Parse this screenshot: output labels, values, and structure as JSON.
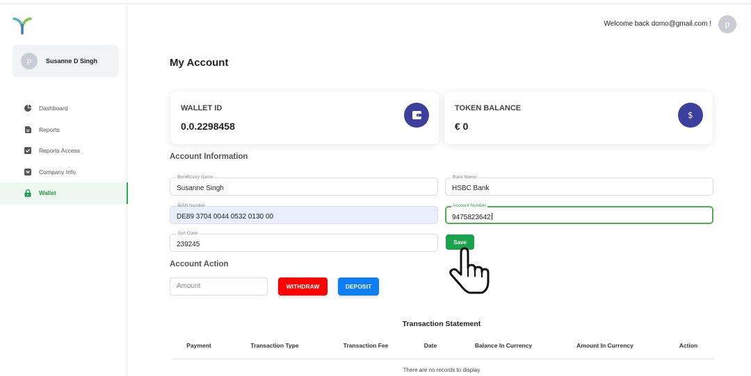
{
  "sidebar": {
    "user": {
      "avatar_letter": "p",
      "name": "Susanne D Singh"
    },
    "items": [
      {
        "label": "Dashboard",
        "icon": "pie-chart-icon"
      },
      {
        "label": "Reports",
        "icon": "document-icon"
      },
      {
        "label": "Reports Access",
        "icon": "checkbox-icon"
      },
      {
        "label": "Company Info",
        "icon": "inbox-icon"
      },
      {
        "label": "Wallet",
        "icon": "lock-icon",
        "active": true
      }
    ]
  },
  "header": {
    "welcome": "Welcome back domo@gmail.com !",
    "avatar_letter": "p"
  },
  "page": {
    "title": "My Account"
  },
  "cards": {
    "wallet": {
      "label": "WALLET ID",
      "value": "0.0.2298458",
      "icon": "wallet-icon"
    },
    "token": {
      "label": "TOKEN BALANCE",
      "value": "€ 0",
      "icon": "dollar-icon"
    }
  },
  "account_info": {
    "title": "Account Information",
    "beneficiary": {
      "label": "Beneficiary Name",
      "value": "Susanne Singh"
    },
    "bank": {
      "label": "Bank Name",
      "value": "HSBC Bank"
    },
    "iban": {
      "label": "IBAN Number",
      "value": "DE89 3704 0044 0532 0130 00"
    },
    "account_number": {
      "label": "Account Number",
      "value": "9475823642"
    },
    "sort_code": {
      "label": "Sort Code",
      "value": "239245"
    },
    "save_label": "Save"
  },
  "account_action": {
    "title": "Account Action",
    "amount_placeholder": "Amount",
    "withdraw_label": "WITHDRAW",
    "deposit_label": "DEPOSIT"
  },
  "statement": {
    "title": "Transaction Statement",
    "columns": [
      "Payment",
      "Transaction Type",
      "Transaction Fee",
      "Date",
      "Balance In Currency",
      "Amount In Currency",
      "Action"
    ],
    "empty_text": "There are no records to display"
  },
  "colors": {
    "accent_green": "#22b04f",
    "card_icon": "#3c3f9c",
    "withdraw": "#ff0000",
    "deposit": "#0d7ef2",
    "save": "#1aa34a"
  }
}
